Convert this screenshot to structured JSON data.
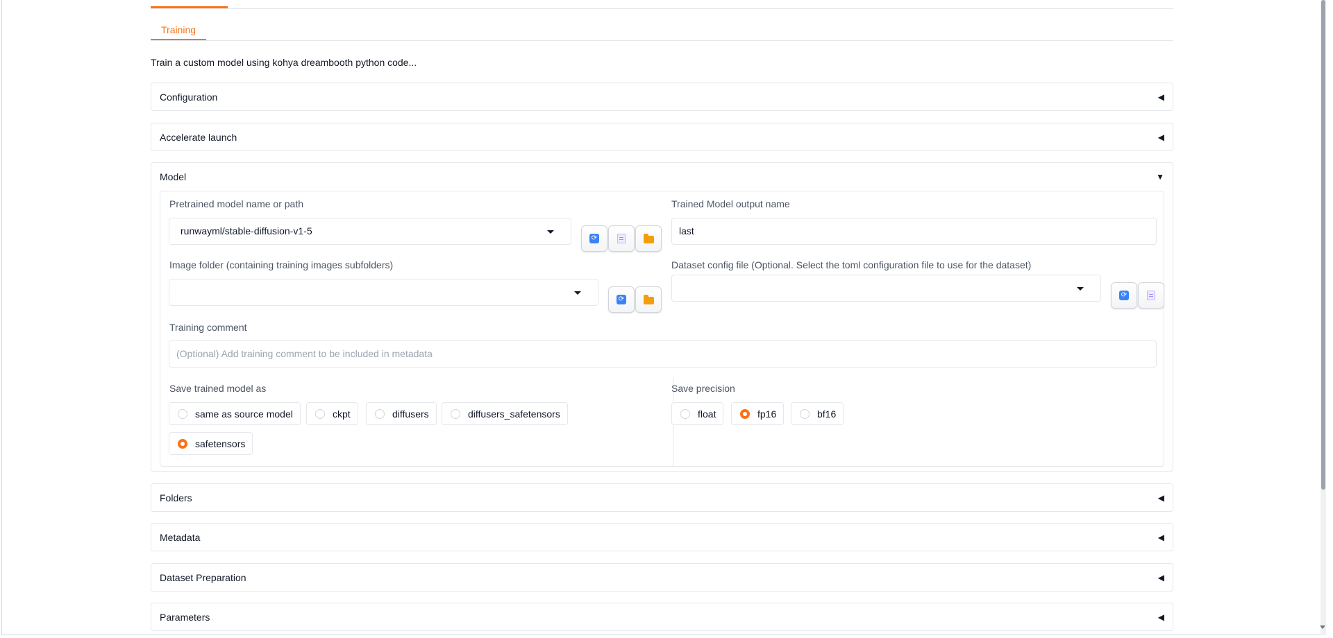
{
  "tabs": {
    "sub_active": "Training"
  },
  "description": "Train a custom model using kohya dreambooth python code...",
  "accordions": {
    "configuration": {
      "title": "Configuration",
      "arrow": "◀"
    },
    "accelerate": {
      "title": "Accelerate launch",
      "arrow": "◀"
    },
    "model": {
      "title": "Model",
      "arrow": "▼"
    },
    "folders": {
      "title": "Folders",
      "arrow": "◀"
    },
    "metadata": {
      "title": "Metadata",
      "arrow": "◀"
    },
    "dataset_prep": {
      "title": "Dataset Preparation",
      "arrow": "◀"
    },
    "parameters": {
      "title": "Parameters",
      "arrow": "◀"
    }
  },
  "model": {
    "pretrained_label": "Pretrained model name or path",
    "pretrained_value": "runwayml/stable-diffusion-v1-5",
    "output_name_label": "Trained Model output name",
    "output_name_value": "last",
    "image_folder_label": "Image folder (containing training images subfolders)",
    "image_folder_value": "",
    "dataset_config_label": "Dataset config file (Optional. Select the toml configuration file to use for the dataset)",
    "dataset_config_value": "",
    "comment_label": "Training comment",
    "comment_placeholder": "(Optional) Add training comment to be included in metadata",
    "save_as_label": "Save trained model as",
    "save_as_options": [
      "same as source model",
      "ckpt",
      "diffusers",
      "diffusers_safetensors",
      "safetensors"
    ],
    "save_as_selected": "safetensors",
    "precision_label": "Save precision",
    "precision_options": [
      "float",
      "fp16",
      "bf16"
    ],
    "precision_selected": "fp16"
  },
  "icons": {
    "refresh": "refresh-icon",
    "document": "document-icon",
    "folder": "folder-icon"
  },
  "colors": {
    "accent": "#f97316",
    "refresh_blue": "#3b82f6",
    "folder_yellow": "#f59e0b"
  }
}
